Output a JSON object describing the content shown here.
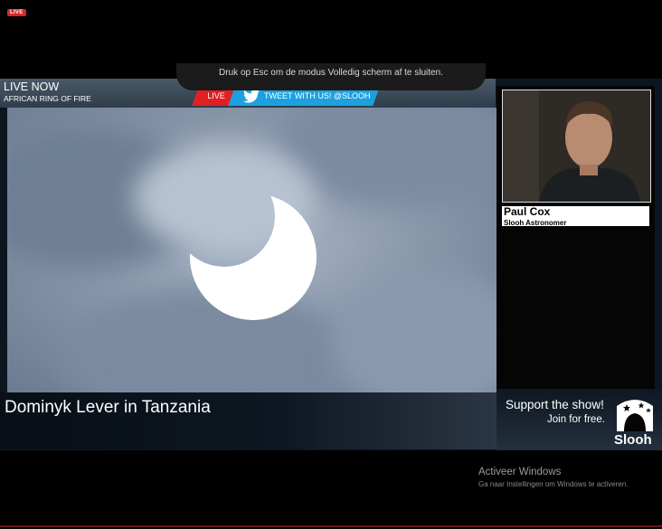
{
  "top_badge": {
    "label": "LIVE"
  },
  "fullscreen_notice": {
    "text": "Druk op Esc om de modus Volledig scherm af te sluiten."
  },
  "stream_header": {
    "live_now": "LIVE NOW",
    "event_title": "AFRICAN RING OF FIRE",
    "live_badge": "LIVE",
    "tweet_label": "TWEET WITH US! @SLOOH",
    "twitter_icon": "twitter-bird-icon"
  },
  "video": {
    "caption": "Dominyk Lever in Tanzania"
  },
  "presenter": {
    "name": "Paul Cox",
    "role": "Slooh Astronomer"
  },
  "promo": {
    "line1": "Support the show!",
    "line2": "Join for free.",
    "brand": "Slooh"
  },
  "windows_activation": {
    "title": "Activeer Windows",
    "subtitle": "Ga naar Instellingen om Windows te activeren."
  },
  "colors": {
    "live_red": "#e01f25",
    "twitter_blue": "#1ca1de"
  }
}
